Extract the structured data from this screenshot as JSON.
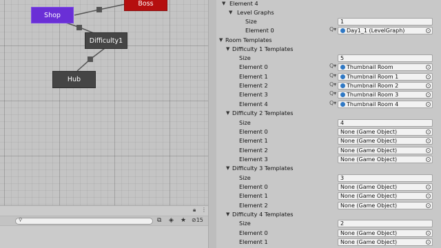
{
  "graph": {
    "nodes": {
      "shop": "Shop",
      "boss": "Boss",
      "difficulty1": "Difficulty1",
      "hub": "Hub"
    }
  },
  "toolbar": {
    "search_placeholder": "",
    "hidden_count": "15",
    "icons": [
      "lock-icon",
      "more-icon",
      "search-icon",
      "scene-filter-icon",
      "tag-icon",
      "star-icon",
      "eye-off-icon"
    ]
  },
  "inspector": {
    "element4_label": "Element 4",
    "level_graphs": {
      "label": "Level Graphs",
      "size_label": "Size",
      "size_value": "1",
      "element0_label": "Element 0",
      "element0_value": "Day1_1 (LevelGraph)"
    },
    "room_templates_label": "Room Templates",
    "difficulty1": {
      "label": "Difficulty 1 Templates",
      "size_label": "Size",
      "size_value": "5",
      "elements": [
        {
          "label": "Element 0",
          "value": "Thumbnail Room"
        },
        {
          "label": "Element 1",
          "value": "Thumbnail Room 1"
        },
        {
          "label": "Element 2",
          "value": "Thumbnail Room 2"
        },
        {
          "label": "Element 3",
          "value": "Thumbnail Room 3"
        },
        {
          "label": "Element 4",
          "value": "Thumbnail Room 4"
        }
      ]
    },
    "difficulty2": {
      "label": "Difficulty 2 Templates",
      "size_label": "Size",
      "size_value": "4",
      "elements": [
        {
          "label": "Element 0",
          "value": "None (Game Object)"
        },
        {
          "label": "Element 1",
          "value": "None (Game Object)"
        },
        {
          "label": "Element 2",
          "value": "None (Game Object)"
        },
        {
          "label": "Element 3",
          "value": "None (Game Object)"
        }
      ]
    },
    "difficulty3": {
      "label": "Difficulty 3 Templates",
      "size_label": "Size",
      "size_value": "3",
      "elements": [
        {
          "label": "Element 0",
          "value": "None (Game Object)"
        },
        {
          "label": "Element 1",
          "value": "None (Game Object)"
        },
        {
          "label": "Element 2",
          "value": "None (Game Object)"
        }
      ]
    },
    "difficulty4": {
      "label": "Difficulty 4 Templates",
      "size_label": "Size",
      "size_value": "2",
      "elements": [
        {
          "label": "Element 0",
          "value": "None (Game Object)"
        },
        {
          "label": "Element 1",
          "value": "None (Game Object)"
        }
      ]
    }
  },
  "colors": {
    "shop_node": "#6a2fd6",
    "boss_node": "#b50f0f",
    "dark_node": "#454545",
    "asset_icon": "#2f78c4"
  }
}
